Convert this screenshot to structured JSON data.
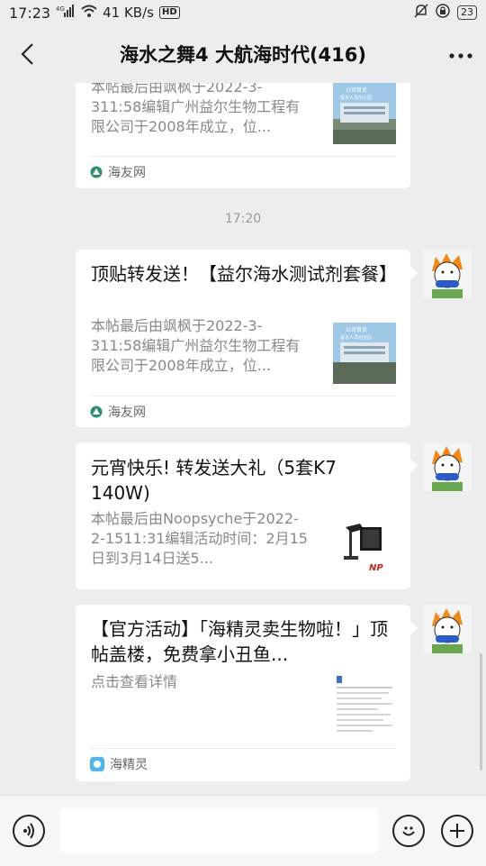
{
  "status": {
    "time": "17:23",
    "network": "4G",
    "speed": "41 KB/s",
    "hd": "HD",
    "battery": "23",
    "icons": [
      "signal-icon",
      "wifi-icon",
      "hd-icon",
      "mute-icon",
      "lock-icon",
      "battery-icon"
    ]
  },
  "header": {
    "title": "海水之舞4 大航海时代(416)",
    "back_icon": "back-icon",
    "more_icon": "more-icon"
  },
  "messages": {
    "m0": {
      "desc": "本帖最后由飒枫于2022-3-311:58编辑广州益尔生物工程有限公司于2008年成立，位...",
      "source": "海友网",
      "thumb_text": [
        "公司首页",
        "留言人员创业园"
      ]
    },
    "timestamp": "17:20",
    "m1": {
      "title": "顶贴转发送！【益尔海水测试剂套餐】",
      "desc": "本帖最后由飒枫于2022-3-311:58编辑广州益尔生物工程有限公司于2008年成立，位...",
      "source": "海友网",
      "thumb_text": [
        "公司首页",
        "留言人员创业园"
      ]
    },
    "m2": {
      "title": "元宵快乐! 转发送大礼（5套K7 140W)",
      "desc": "本帖最后由Noopsyche于2022-2-1511:31编辑活动时间：2月15日到3月14日送5...",
      "thumb_text": "NP"
    },
    "m3": {
      "title": "【官方活动】「海精灵卖生物啦！」顶帖盖楼，免费拿小丑鱼...",
      "desc": "点击查看详情",
      "source": "海精灵"
    }
  },
  "input_bar": {
    "voice_icon": "voice-icon",
    "emoji_icon": "emoji-icon",
    "plus_icon": "plus-icon"
  },
  "colors": {
    "background": "#ededed",
    "card": "#ffffff",
    "muted": "#888888",
    "source_icon_green": "#2f8f6f"
  }
}
